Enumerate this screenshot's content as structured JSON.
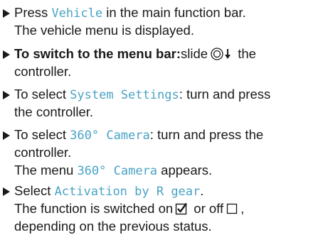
{
  "steps": [
    {
      "lines": [
        {
          "before": "Press ",
          "ui": "Vehicle",
          "after": " in the main function bar."
        },
        {
          "text": "The vehicle menu is displayed."
        }
      ]
    },
    {
      "lines": [
        {
          "bold": "To switch to the menu bar:",
          "text": "slide",
          "after": " the"
        },
        {
          "text": "controller."
        }
      ]
    },
    {
      "lines": [
        {
          "before": "To select ",
          "ui": "System Settings",
          "after": ": turn and press"
        },
        {
          "text": "the controller."
        }
      ]
    },
    {
      "lines": [
        {
          "before": "To select ",
          "ui": "360° Camera",
          "after": ": turn and press the"
        },
        {
          "text": "controller."
        },
        {
          "before": "The menu ",
          "ui": "360° Camera",
          "after": " appears."
        }
      ]
    },
    {
      "lines": [
        {
          "before": "Select ",
          "ui": "Activation by R gear",
          "after": "."
        },
        {
          "text": "The function is switched on",
          "middle": " or off",
          "after": ","
        },
        {
          "text": "depending on the previous status."
        }
      ]
    }
  ],
  "icons": {
    "controller": "controller-slide-down-icon",
    "checked": "checkbox-checked-icon",
    "unchecked": "checkbox-unchecked-icon"
  }
}
